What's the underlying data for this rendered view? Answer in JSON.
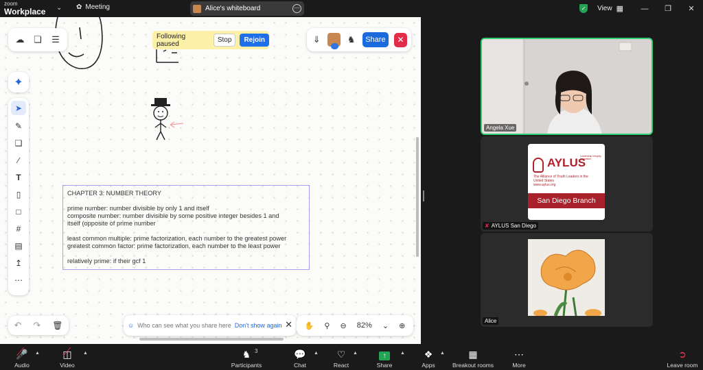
{
  "titlebar": {
    "logo_top": "zoom",
    "logo_bottom": "Workplace",
    "meeting_label": "Meeting",
    "tab_title": "Alice's whiteboard",
    "view_label": "View",
    "security_color": "#23a455"
  },
  "whiteboard": {
    "follow": {
      "text": "Following paused",
      "stop": "Stop",
      "rejoin": "Rejoin"
    },
    "share_label": "Share",
    "notice": {
      "text": "Who can see what you share here",
      "link": "Don't show again"
    },
    "zoom_level": "82%",
    "textbox": {
      "title": "CHAPTER 3: NUMBER THEORY",
      "lines": [
        "prime number: number divisible by only 1 and itself",
        "composite number: number divisible by some positive integer besides 1 and",
        "itself (opposite of prime number",
        "least common multiple: prime factorization, each number to the greatest power",
        "greatest common factor: prime factorization, each number to the least power",
        "relatively prime: if their gcf 1"
      ]
    },
    "tools": [
      "select-icon",
      "pen-icon",
      "shapes-icon",
      "line-icon",
      "text-icon",
      "sticky-note-icon",
      "comment-icon",
      "frame-icon",
      "template-icon",
      "upload-icon",
      "more-icon"
    ]
  },
  "participants_panel": {
    "tiles": [
      {
        "name": "Angela Xue"
      },
      {
        "name": "AYLUS San Diego"
      },
      {
        "name": "Alice"
      }
    ],
    "aylus_card": {
      "logo": "AYLUS",
      "tagline": "Leadership Integrity Innovation",
      "subtitle": "The Alliance of Youth Leaders in the United States",
      "url": "www.aylus.org",
      "branch": "San Diego Branch"
    }
  },
  "bottombar": {
    "audio": "Audio",
    "video": "Video",
    "participants": "Participants",
    "participants_count": "3",
    "chat": "Chat",
    "react": "React",
    "share": "Share",
    "apps": "Apps",
    "breakout": "Breakout rooms",
    "more": "More",
    "leave": "Leave room"
  }
}
